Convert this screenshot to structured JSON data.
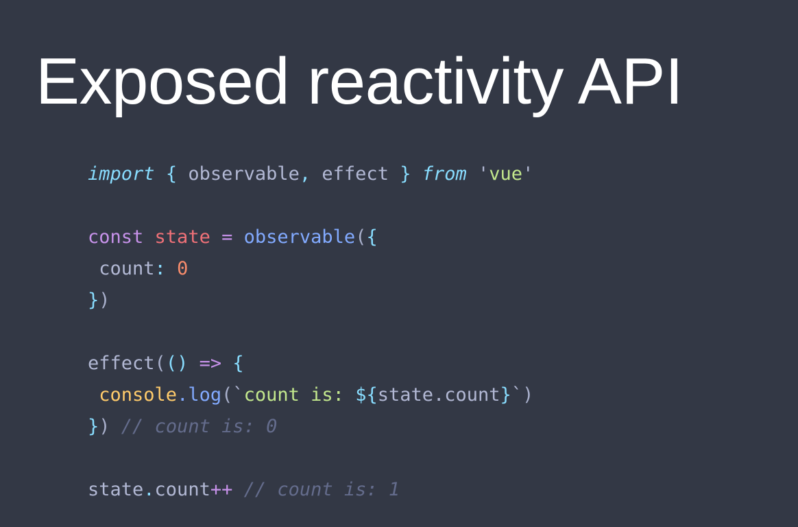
{
  "slide": {
    "title": "Exposed reactivity API",
    "background_color": "#333845",
    "title_color": "#ffffff"
  },
  "code": {
    "language": "javascript",
    "theme_colors": {
      "keyword": "#89ddff",
      "identifier": "#b2b8d4",
      "string": "#c3e88d",
      "const_keyword": "#c792ea",
      "variable": "#f07178",
      "function": "#82aaff",
      "number": "#f78c6c",
      "object": "#ffcb6b",
      "comment": "#646c8c",
      "punctuation": "#89ddff"
    },
    "full_text": "import { observable, effect } from 'vue'\n\nconst state = observable({\n count: 0\n})\n\neffect(() => {\n console.log(`count is: ${state.count}`)\n}) // count is: 0\n\nstate.count++ // count is: 1",
    "lines": [
      {
        "id": "line-import",
        "tokens": [
          {
            "t": "import",
            "c": "tok-keyword"
          },
          {
            "t": " ",
            "c": "tok-ident"
          },
          {
            "t": "{",
            "c": "tok-punct"
          },
          {
            "t": " observable",
            "c": "tok-ident"
          },
          {
            "t": ",",
            "c": "tok-punct"
          },
          {
            "t": " effect ",
            "c": "tok-ident"
          },
          {
            "t": "}",
            "c": "tok-punct"
          },
          {
            "t": " ",
            "c": "tok-ident"
          },
          {
            "t": "from",
            "c": "tok-keyword"
          },
          {
            "t": " ",
            "c": "tok-ident"
          },
          {
            "t": "'",
            "c": "tok-quote"
          },
          {
            "t": "vue",
            "c": "tok-string"
          },
          {
            "t": "'",
            "c": "tok-quote"
          }
        ]
      },
      {
        "id": "line-blank-1",
        "tokens": []
      },
      {
        "id": "line-const-state",
        "tokens": [
          {
            "t": "const",
            "c": "tok-const"
          },
          {
            "t": " ",
            "c": "tok-ident"
          },
          {
            "t": "state",
            "c": "tok-var"
          },
          {
            "t": " ",
            "c": "tok-ident"
          },
          {
            "t": "=",
            "c": "tok-operator"
          },
          {
            "t": " ",
            "c": "tok-ident"
          },
          {
            "t": "observable",
            "c": "tok-func"
          },
          {
            "t": "(",
            "c": "tok-paren"
          },
          {
            "t": "{",
            "c": "tok-punct"
          }
        ]
      },
      {
        "id": "line-count-prop",
        "tokens": [
          {
            "t": " count",
            "c": "tok-ident"
          },
          {
            "t": ":",
            "c": "tok-punct"
          },
          {
            "t": " ",
            "c": "tok-ident"
          },
          {
            "t": "0",
            "c": "tok-number"
          }
        ]
      },
      {
        "id": "line-close-observable",
        "tokens": [
          {
            "t": "}",
            "c": "tok-punct"
          },
          {
            "t": ")",
            "c": "tok-paren"
          }
        ]
      },
      {
        "id": "line-blank-2",
        "tokens": []
      },
      {
        "id": "line-effect-open",
        "tokens": [
          {
            "t": "effect",
            "c": "tok-ident"
          },
          {
            "t": "(",
            "c": "tok-paren"
          },
          {
            "t": "()",
            "c": "tok-punct"
          },
          {
            "t": " ",
            "c": "tok-ident"
          },
          {
            "t": "=>",
            "c": "tok-operator"
          },
          {
            "t": " ",
            "c": "tok-ident"
          },
          {
            "t": "{",
            "c": "tok-punct"
          }
        ]
      },
      {
        "id": "line-console-log",
        "tokens": [
          {
            "t": " ",
            "c": "tok-ident"
          },
          {
            "t": "console",
            "c": "tok-object"
          },
          {
            "t": ".",
            "c": "tok-dot-blue"
          },
          {
            "t": "log",
            "c": "tok-func"
          },
          {
            "t": "(",
            "c": "tok-paren"
          },
          {
            "t": "`",
            "c": "tok-quote"
          },
          {
            "t": "count is: ",
            "c": "tok-string"
          },
          {
            "t": "${",
            "c": "tok-punct"
          },
          {
            "t": "state",
            "c": "tok-ident"
          },
          {
            "t": ".",
            "c": "tok-ident"
          },
          {
            "t": "count",
            "c": "tok-ident"
          },
          {
            "t": "}",
            "c": "tok-punct"
          },
          {
            "t": "`",
            "c": "tok-quote"
          },
          {
            "t": ")",
            "c": "tok-paren"
          }
        ]
      },
      {
        "id": "line-close-effect",
        "tokens": [
          {
            "t": "}",
            "c": "tok-punct"
          },
          {
            "t": ")",
            "c": "tok-paren"
          },
          {
            "t": " ",
            "c": "tok-ident"
          },
          {
            "t": "// count is: 0",
            "c": "tok-comment"
          }
        ]
      },
      {
        "id": "line-blank-3",
        "tokens": []
      },
      {
        "id": "line-increment",
        "tokens": [
          {
            "t": "state",
            "c": "tok-ident"
          },
          {
            "t": ".",
            "c": "tok-dot"
          },
          {
            "t": "count",
            "c": "tok-ident"
          },
          {
            "t": "++",
            "c": "tok-operator"
          },
          {
            "t": " ",
            "c": "tok-ident"
          },
          {
            "t": "// count is: 1",
            "c": "tok-comment"
          }
        ]
      }
    ]
  }
}
